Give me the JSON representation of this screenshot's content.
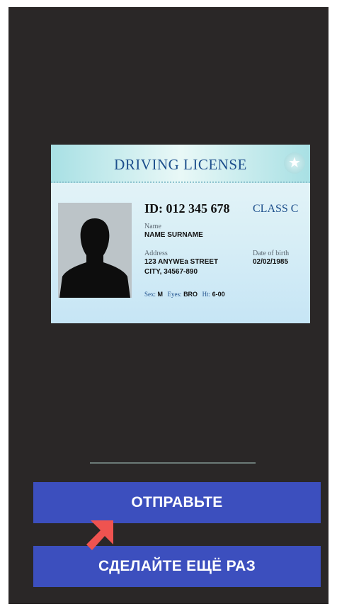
{
  "license_card": {
    "title": "DRIVING LICENSE",
    "id_label": "ID: 012 345 678",
    "class_label": "CLASS C",
    "name_label": "Name",
    "name_value": "NAME SURNAME",
    "address_label": "Address",
    "address_line1": "123 ANYWEa STREET",
    "address_line2": "CITY, 34567-890",
    "dob_label": "Date of birth",
    "dob_value": "02/02/1985",
    "sex_label": "Sex:",
    "sex_value": "M",
    "eyes_label": "Eyes:",
    "eyes_value": "BRO",
    "height_label": "Ht:",
    "height_value": "6-00",
    "seal_icon": "star-seal-icon",
    "photo_icon": "person-silhouette-icon"
  },
  "actions": {
    "send_label": "ОТПРАВЬТЕ",
    "retake_label": "СДЕЛАЙТЕ ЕЩЁ РАЗ"
  },
  "pointer": {
    "icon": "pointer-arrow-icon",
    "color": "#ef5350"
  },
  "colors": {
    "background": "#2a2727",
    "button": "#3c4fbe",
    "card_title": "#1d4f8c"
  }
}
